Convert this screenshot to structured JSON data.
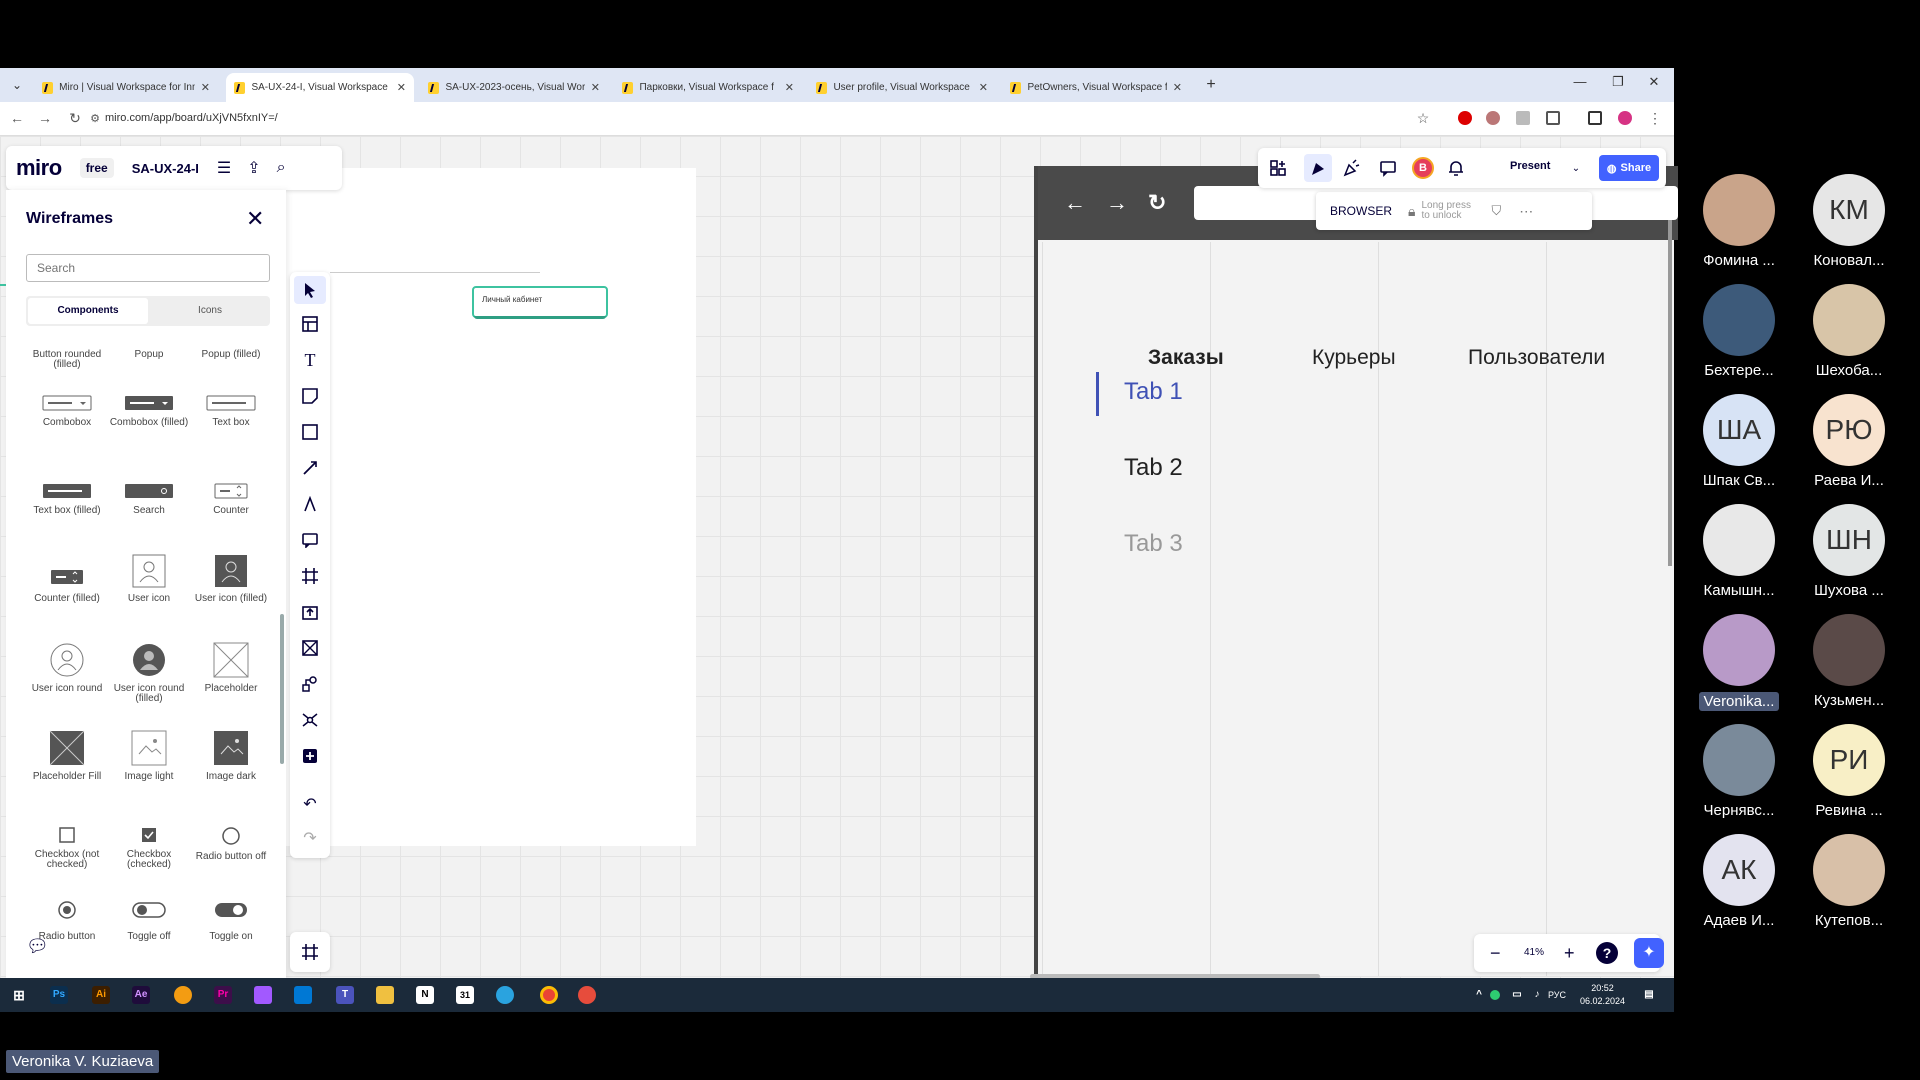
{
  "browser": {
    "tabs": [
      {
        "title": "Miro | Visual Workspace for Inn",
        "active": false
      },
      {
        "title": "SA-UX-24-I, Visual Workspace",
        "active": true
      },
      {
        "title": "SA-UX-2023-осень, Visual Wor",
        "active": false
      },
      {
        "title": "Парковки, Visual Workspace f",
        "active": false
      },
      {
        "title": "User profile, Visual Workspace",
        "active": false
      },
      {
        "title": "PetOwners, Visual Workspace f",
        "active": false
      }
    ],
    "new_tab": "+",
    "url": "miro.com/app/board/uXjVN5fxnIY=/"
  },
  "miro": {
    "logo": "miro",
    "plan": "free",
    "board_name": "SA-UX-24-I"
  },
  "panel": {
    "title": "Wireframes",
    "search_placeholder": "Search",
    "tabs": [
      "Components",
      "Icons"
    ],
    "items": [
      {
        "label": "Button rounded (filled)"
      },
      {
        "label": "Popup"
      },
      {
        "label": "Popup (filled)"
      },
      {
        "label": "Combobox"
      },
      {
        "label": "Combobox (filled)"
      },
      {
        "label": "Text box"
      },
      {
        "label": "Text box (filled)"
      },
      {
        "label": "Search"
      },
      {
        "label": "Counter"
      },
      {
        "label": "Counter (filled)"
      },
      {
        "label": "User icon"
      },
      {
        "label": "User icon (filled)"
      },
      {
        "label": "User icon round"
      },
      {
        "label": "User icon round (filled)"
      },
      {
        "label": "Placeholder"
      },
      {
        "label": "Placeholder Fill"
      },
      {
        "label": "Image light"
      },
      {
        "label": "Image dark"
      },
      {
        "label": "Checkbox (not checked)"
      },
      {
        "label": "Checkbox (checked)"
      },
      {
        "label": "Radio button off"
      },
      {
        "label": "Radio button"
      },
      {
        "label": "Toggle off"
      },
      {
        "label": "Toggle on"
      }
    ]
  },
  "canvas": {
    "lk_button": "Личный кабинет",
    "browser_wireframe": {
      "top_tabs": [
        "Заказы",
        "Курьеры",
        "Пользователи"
      ],
      "side_tabs": [
        "Tab 1",
        "Tab 2",
        "Tab 3"
      ]
    },
    "lock_overlay": {
      "label": "BROWSER",
      "hint": "Long press to unlock"
    }
  },
  "topbar": {
    "present": "Present",
    "share": "Share",
    "avatar_letter": "В"
  },
  "zoom": {
    "value": "41%",
    "help": "?"
  },
  "taskbar": {
    "lang": "РУС",
    "time": "20:52",
    "date": "06.02.2024"
  },
  "participants": [
    {
      "name": "Фомина ...",
      "initials": "",
      "color": "#c9a48a"
    },
    {
      "name": "Коновал...",
      "initials": "КМ",
      "color": "#e6e6e6"
    },
    {
      "name": "Бехтере...",
      "initials": "",
      "color": "#3d5a7a"
    },
    {
      "name": "Шехоба...",
      "initials": "",
      "color": "#d8c5a8"
    },
    {
      "name": "Шпак Св...",
      "initials": "ША",
      "color": "#d7e3f5"
    },
    {
      "name": "Раева И...",
      "initials": "РЮ",
      "color": "#f8e3cf"
    },
    {
      "name": "Камышн...",
      "initials": "",
      "color": "#e8e8e8"
    },
    {
      "name": "Шухова ...",
      "initials": "ШН",
      "color": "#e3e6e6"
    },
    {
      "name": "Veronika...",
      "initials": "",
      "color": "#b89ac8",
      "highlight": true
    },
    {
      "name": "Кузьмен...",
      "initials": "",
      "color": "#5a4a48"
    },
    {
      "name": "Чернявс...",
      "initials": "",
      "color": "#7a8a9a"
    },
    {
      "name": "Ревина ...",
      "initials": "РИ",
      "color": "#f8efc6"
    },
    {
      "name": "Адаев И...",
      "initials": "АК",
      "color": "#e3e3ef"
    },
    {
      "name": "Кутепов...",
      "initials": "",
      "color": "#d8c0a8"
    }
  ],
  "speaker": "Veronika V. Kuziaeva"
}
